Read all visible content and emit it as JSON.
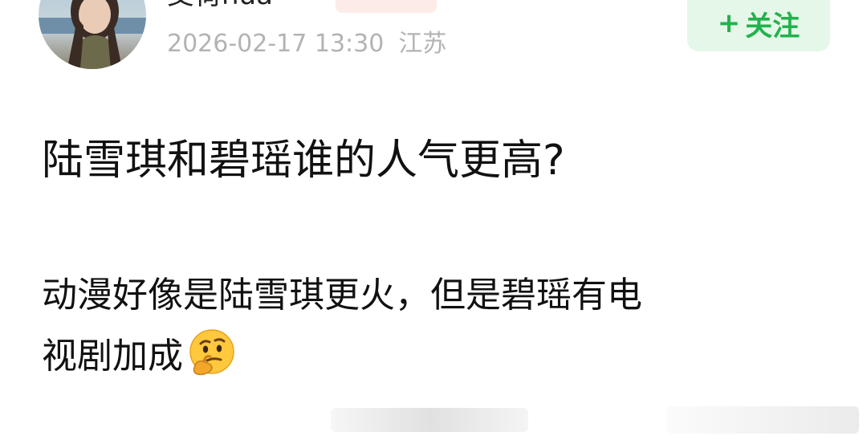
{
  "header": {
    "username": "艾荷hua",
    "date": "2026-02-17 13:30",
    "location": "江苏",
    "follow_label": "关注",
    "follow_plus": "+"
  },
  "post": {
    "title": "陆雪琪和碧瑶谁的人气更高?",
    "body_line1": "动漫好像是陆雪琪更火，但是碧瑶有电",
    "body_line2": "视剧加成"
  },
  "colors": {
    "follow_text": "#22b24c",
    "follow_bg": "#e5f7e9",
    "meta_gray": "#b3b3b3",
    "tag_bg": "#fdebe8"
  },
  "icons": {
    "emoji": "thinking-face-icon"
  }
}
